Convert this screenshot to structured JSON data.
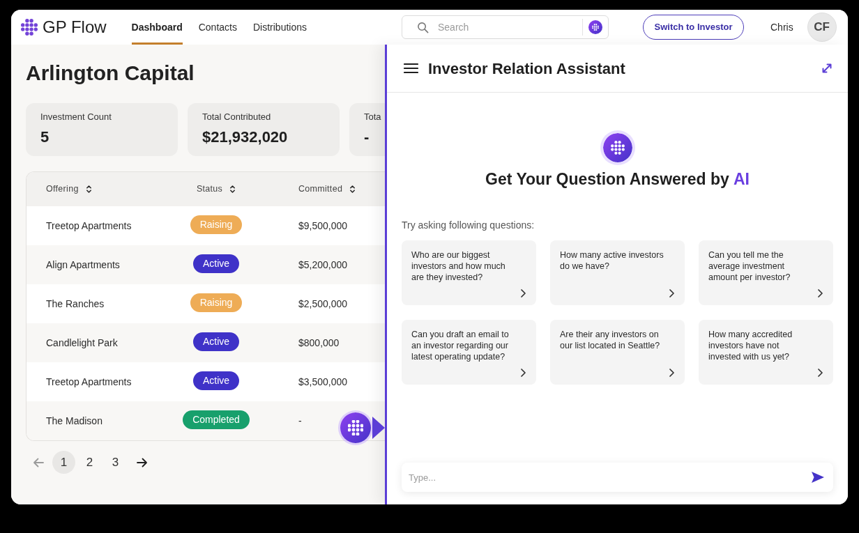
{
  "header": {
    "brand": "GP Flow",
    "nav": [
      {
        "label": "Dashboard",
        "selected": true
      },
      {
        "label": "Contacts",
        "selected": false
      },
      {
        "label": "Distributions",
        "selected": false
      }
    ],
    "search": {
      "placeholder": "Search"
    },
    "switch_button": "Switch to Investor",
    "user": {
      "name": "Chris",
      "initials": "CF"
    }
  },
  "page": {
    "title": "Arlington Capital",
    "stats": [
      {
        "label": "Investment Count",
        "value": "5"
      },
      {
        "label": "Total Contributed",
        "value": "$21,932,020"
      },
      {
        "label": "Tota",
        "value": "-"
      }
    ],
    "table": {
      "columns": [
        "Offering",
        "Status",
        "Committed"
      ],
      "rows": [
        {
          "offering": "Treetop Apartments",
          "status": {
            "label": "Raising",
            "color": "#eeac56"
          },
          "committed": "$9,500,000"
        },
        {
          "offering": "Align Apartments",
          "status": {
            "label": "Active",
            "color": "#3f32c8"
          },
          "committed": "$5,200,000"
        },
        {
          "offering": "The Ranches",
          "status": {
            "label": "Raising",
            "color": "#eeac56"
          },
          "committed": "$2,500,000"
        },
        {
          "offering": "Candlelight Park",
          "status": {
            "label": "Active",
            "color": "#3f32c8"
          },
          "committed": "$800,000"
        },
        {
          "offering": "Treetop Apartments",
          "status": {
            "label": "Active",
            "color": "#3f32c8"
          },
          "committed": "$3,500,000"
        },
        {
          "offering": "The Madison",
          "status": {
            "label": "Completed",
            "color": "#18a06c"
          },
          "committed": "-"
        }
      ]
    },
    "pagination": {
      "previous": {
        "disabled": true
      },
      "pages": [
        {
          "label": "1",
          "selected": true
        },
        {
          "label": "2",
          "selected": false
        },
        {
          "label": "3",
          "selected": false
        }
      ],
      "next": {
        "disabled": false
      }
    }
  },
  "assistant": {
    "title": "Investor Relation Assistant",
    "heading": {
      "text": "Get Your Question Answered by",
      "highlight": "AI"
    },
    "prompt_intro": "Try asking following questions:",
    "suggestions": [
      "Who are our biggest investors and how much are they invested?",
      "How many active investors do we have?",
      "Can you tell me the average investment amount per investor?",
      "Can you draft an email to an investor regarding our latest operating update?",
      "Are their any investors on our list located in Seattle?",
      "How many accredited investors have not invested with us yet?"
    ],
    "input": {
      "placeholder": "Type..."
    }
  }
}
